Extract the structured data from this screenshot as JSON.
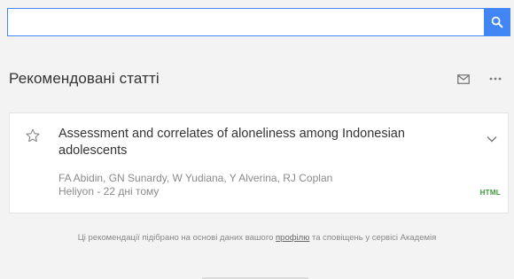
{
  "search": {
    "value": "",
    "placeholder": ""
  },
  "icons": {
    "search": "search-icon",
    "mail": "envelope-icon",
    "more": "more-horizontal-icon",
    "star": "star-outline-icon",
    "chevron": "chevron-down-icon"
  },
  "colors": {
    "accent": "#4285f4",
    "badge_green": "#3a9b3a"
  },
  "section": {
    "title": "Рекомендовані статті",
    "more_label": "···"
  },
  "article": {
    "title": "Assessment and correlates of aloneliness among Indonesian adolescents",
    "authors": "FA Abidin, GN Sunardy, W Yudiana, Y Alverina, RJ Coplan",
    "source": "Heliyon - 22 дні тому",
    "format_badge": "HTML"
  },
  "footer": {
    "text_before": "Ці рекомендації підібрано на основі даних вашого ",
    "link": "профілю",
    "text_after": " та сповіщень у сервісі Академія"
  }
}
